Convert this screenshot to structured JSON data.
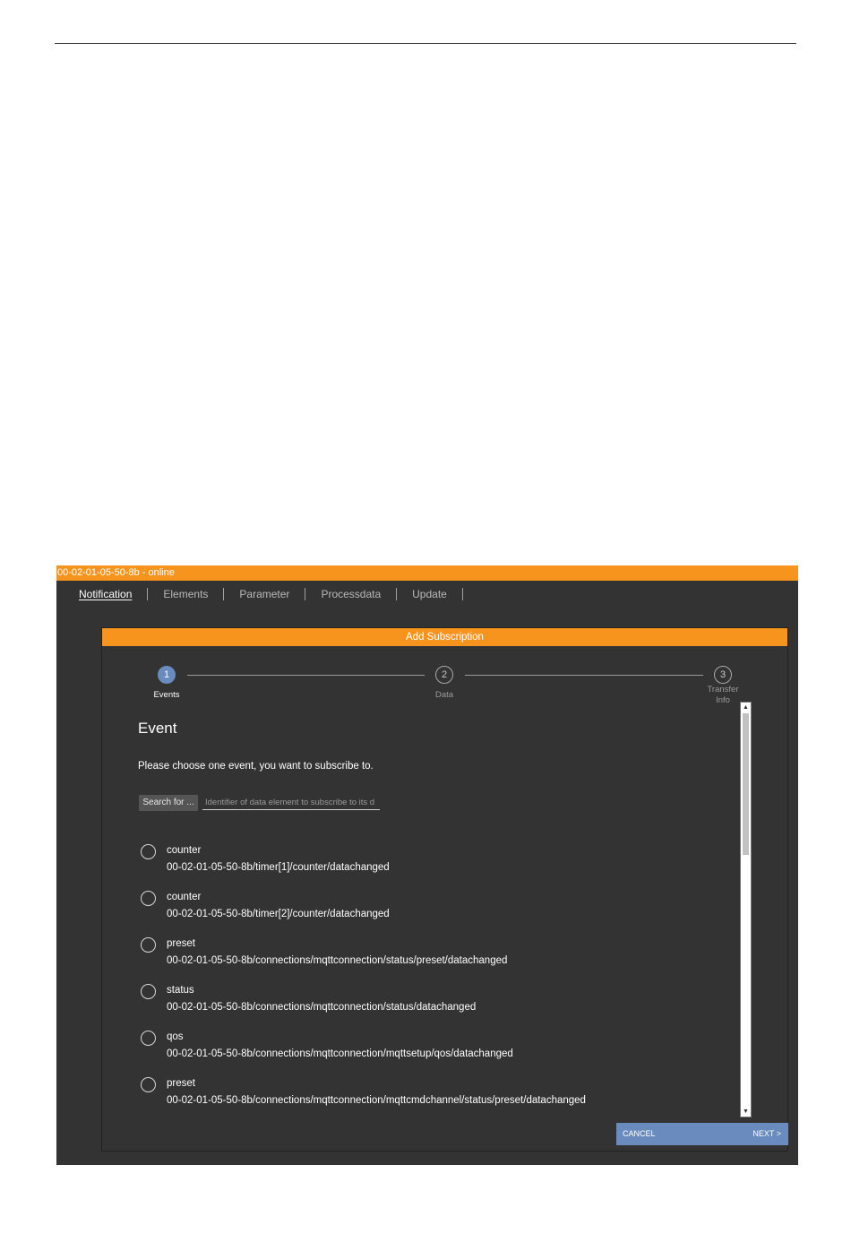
{
  "status_bar": {
    "text": "00-02-01-05-50-8b - online"
  },
  "nav": {
    "tabs": [
      {
        "label": "Notification",
        "active": true
      },
      {
        "label": "Elements",
        "active": false
      },
      {
        "label": "Parameter",
        "active": false
      },
      {
        "label": "Processdata",
        "active": false
      },
      {
        "label": "Update",
        "active": false
      }
    ]
  },
  "dialog": {
    "title": "Add Subscription",
    "steps": [
      {
        "number": "1",
        "label": "Events",
        "active": true
      },
      {
        "number": "2",
        "label": "Data",
        "active": false
      },
      {
        "number": "3",
        "label": "Transfer Info",
        "active": false
      }
    ],
    "heading": "Event",
    "description": "Please choose one event, you want to subscribe to.",
    "search": {
      "button_label": "Search for ...",
      "placeholder": "Identifier of data element to subscribe to its d"
    },
    "events": [
      {
        "name": "counter",
        "path": "00-02-01-05-50-8b/timer[1]/counter/datachanged"
      },
      {
        "name": "counter",
        "path": "00-02-01-05-50-8b/timer[2]/counter/datachanged"
      },
      {
        "name": "preset",
        "path": "00-02-01-05-50-8b/connections/mqttconnection/status/preset/datachanged"
      },
      {
        "name": "status",
        "path": "00-02-01-05-50-8b/connections/mqttconnection/status/datachanged"
      },
      {
        "name": "qos",
        "path": "00-02-01-05-50-8b/connections/mqttconnection/mqttsetup/qos/datachanged"
      },
      {
        "name": "preset",
        "path": "00-02-01-05-50-8b/connections/mqttconnection/mqttcmdchannel/status/preset/datachanged"
      }
    ],
    "footer": {
      "cancel_label": "CANCEL",
      "next_label": "NEXT >"
    }
  },
  "colors": {
    "accent_orange": "#f7941d",
    "accent_blue": "#6a8bbd",
    "panel_bg": "#333333"
  },
  "icons": {
    "scroll_up": "triangle-up-icon",
    "scroll_down": "triangle-down-icon"
  }
}
